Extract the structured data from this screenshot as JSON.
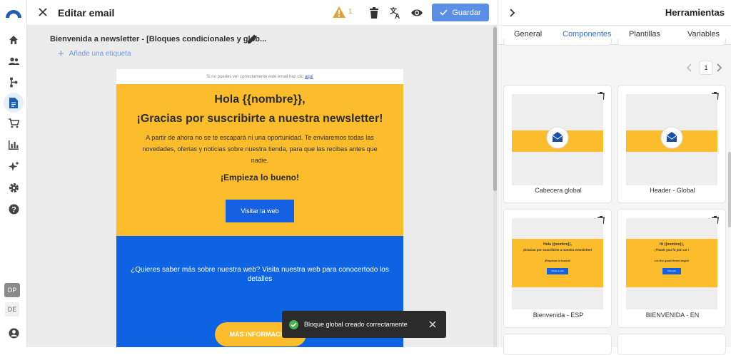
{
  "header": {
    "title": "Editar email",
    "warnings_count": "1",
    "save_label": "Guardar"
  },
  "email": {
    "name": "Bienvenida a newsletter - [Bloques condicionales y glob...",
    "add_tag": "Añade una etiqueta",
    "preheader_text": "Si no puedes ver correctamente este email haz clic",
    "preheader_link": "aquí",
    "greeting": "Hola {{nombre}},",
    "headline": "¡Gracias por suscribirte a nuestra newsletter!",
    "paragraph": "A partir de ahora no se te escapará ni una oportunidad. Te enviaremos todas las novedades, ofertas y noticias sobre nuestra tienda, para que las recibas antes que nadie.",
    "subhead": "¡Empieza lo bueno!",
    "cta": "Visitar la web",
    "blue_question": "¿Quieres saber más sobre nuestra web? Visita nuestra web para conocertodo los detalles",
    "more_button": "MÁS INFORMACIÓN"
  },
  "toast": {
    "message": "Bloque global creado correctamente"
  },
  "user": {
    "initials": "DP",
    "lang": "DE"
  },
  "panel": {
    "title": "Herramientas",
    "tabs": [
      "General",
      "Componentes",
      "Plantillas",
      "Variables"
    ],
    "active_tab": "Componentes",
    "page": "1",
    "cards": [
      {
        "label": "Cabecera global"
      },
      {
        "label": "Header - Global"
      },
      {
        "label": "Bienvenida - ESP",
        "mini_title": "Hola {{nombre}},",
        "mini_sub": "¡Gracias por suscribirte a nuestra newsletter!",
        "mini_tag": "¡Empieza lo bueno!",
        "mini_btn": "Visitar la web"
      },
      {
        "label": "BIENVENIDA - EN",
        "mini_title": "Hi {{nombre}},",
        "mini_sub": "¡Thank you fo join us !",
        "mini_tag": "Let the good times begin!",
        "mini_btn": "Visit web"
      }
    ]
  },
  "colors": {
    "accent": "#5b8fe6",
    "email_yellow": "#fbbd2c",
    "email_blue": "#0d63e2",
    "toast_bg": "#2b2b2b",
    "success": "#4caf50"
  },
  "icons": {
    "rail": [
      "home-icon",
      "users-icon",
      "flow-icon",
      "document-icon",
      "cart-icon",
      "bar-chart-icon",
      "sparkle-icon",
      "gear-icon",
      "help-icon",
      "account-icon"
    ],
    "toolbar": [
      "warning-icon",
      "trash-icon",
      "translate-icon",
      "eye-icon",
      "check-icon"
    ]
  }
}
